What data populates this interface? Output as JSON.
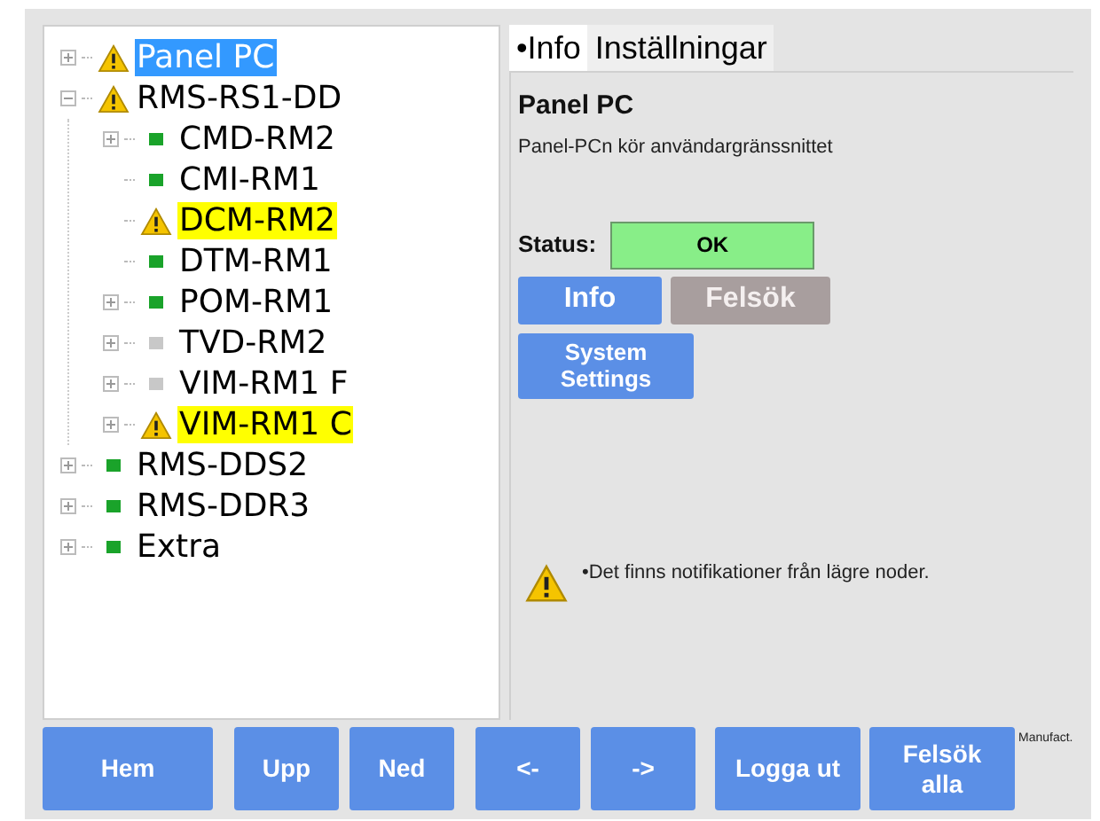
{
  "tree": [
    {
      "label": "Panel PC",
      "kind": "warning",
      "expandable": true,
      "expanded": false,
      "selected": true
    },
    {
      "label": "RMS-RS1-DD",
      "kind": "warning",
      "expandable": true,
      "expanded": true,
      "selected": false,
      "children": [
        {
          "label": "CMD-RM2",
          "kind": "ok",
          "expandable": true,
          "expanded": false,
          "selected": false
        },
        {
          "label": "CMI-RM1",
          "kind": "ok",
          "expandable": false,
          "selected": false
        },
        {
          "label": "DCM-RM2",
          "kind": "warning",
          "expandable": false,
          "selected": false,
          "highlighted": true
        },
        {
          "label": "DTM-RM1",
          "kind": "ok",
          "expandable": false,
          "selected": false
        },
        {
          "label": "POM-RM1",
          "kind": "ok",
          "expandable": true,
          "expanded": false,
          "selected": false
        },
        {
          "label": "TVD-RM2",
          "kind": "inactive",
          "expandable": true,
          "expanded": false,
          "selected": false
        },
        {
          "label": "VIM-RM1 F",
          "kind": "inactive",
          "expandable": true,
          "expanded": false,
          "selected": false
        },
        {
          "label": "VIM-RM1 C",
          "kind": "warning",
          "expandable": true,
          "expanded": false,
          "selected": false,
          "highlighted": true
        }
      ]
    },
    {
      "label": "RMS-DDS2",
      "kind": "ok",
      "expandable": true,
      "expanded": false,
      "selected": false
    },
    {
      "label": "RMS-DDR3",
      "kind": "ok",
      "expandable": true,
      "expanded": false,
      "selected": false
    },
    {
      "label": "Extra",
      "kind": "ok",
      "expandable": true,
      "expanded": false,
      "selected": false
    }
  ],
  "tabs": [
    {
      "label": "•Info",
      "selected": true
    },
    {
      "label": "Inställningar",
      "selected": false
    }
  ],
  "details": {
    "title": "Panel PC",
    "description": "Panel-PCn kör användargränssnittet",
    "status_label": "Status:",
    "status_value": "OK",
    "status_ok": true
  },
  "detail_buttons": [
    {
      "label": "Info",
      "disabled": false
    },
    {
      "label": "Felsök",
      "disabled": true
    },
    {
      "label": "System Settings",
      "disabled": false
    }
  ],
  "notification": "•Det finns notifikationer från lägre noder.",
  "bottom_buttons": [
    {
      "label": "Hem"
    },
    {
      "label": "Upp"
    },
    {
      "label": "Ned"
    },
    {
      "label": "<-"
    },
    {
      "label": "->"
    },
    {
      "label": "Logga ut"
    },
    {
      "label": "Felsök alla"
    }
  ],
  "footer_label": "Manufact."
}
